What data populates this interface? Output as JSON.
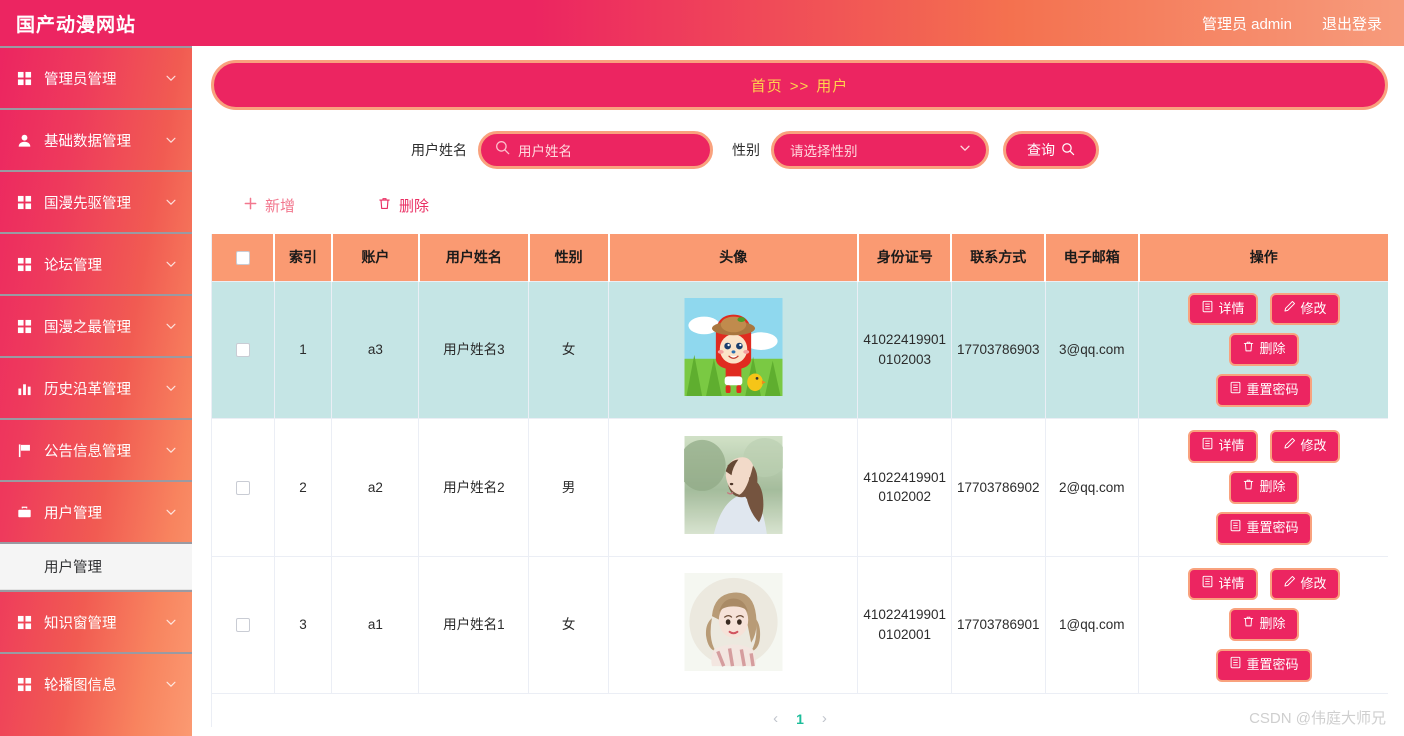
{
  "topbar": {
    "brand": "国产动漫网站",
    "user": "管理员 admin",
    "logout": "退出登录"
  },
  "sidebar": {
    "items": [
      {
        "label": "管理员管理",
        "icon": "grid-icon"
      },
      {
        "label": "基础数据管理",
        "icon": "user-icon"
      },
      {
        "label": "国漫先驱管理",
        "icon": "grid-icon"
      },
      {
        "label": "论坛管理",
        "icon": "grid-icon"
      },
      {
        "label": "国漫之最管理",
        "icon": "grid-icon"
      },
      {
        "label": "历史沿革管理",
        "icon": "bar-chart-icon"
      },
      {
        "label": "公告信息管理",
        "icon": "flag-icon"
      },
      {
        "label": "用户管理",
        "icon": "briefcase-icon",
        "submenu": [
          "用户管理"
        ]
      },
      {
        "label": "知识窗管理",
        "icon": "grid-icon"
      },
      {
        "label": "轮播图信息",
        "icon": "grid-icon"
      }
    ]
  },
  "banner": {
    "home": "首页",
    "separator": ">>",
    "current": "用户"
  },
  "search": {
    "name_label": "用户姓名",
    "name_placeholder": "用户姓名",
    "name_value": "",
    "gender_label": "性别",
    "gender_placeholder": "请选择性别",
    "gender_value": "",
    "query_button": "查询"
  },
  "toolbar": {
    "add_label": "新增",
    "delete_label": "删除"
  },
  "table": {
    "columns": [
      "",
      "索引",
      "账户",
      "用户姓名",
      "性别",
      "头像",
      "身份证号",
      "联系方式",
      "电子邮箱",
      "操作"
    ],
    "rows": [
      {
        "index": "1",
        "account": "a3",
        "name": "用户姓名3",
        "gender": "女",
        "avatar": "cartoon-mascot-avatar",
        "id_number": "410224199010102003",
        "phone": "17703786903",
        "email": "3@qq.com",
        "highlight": true
      },
      {
        "index": "2",
        "account": "a2",
        "name": "用户姓名2",
        "gender": "男",
        "avatar": "photo-girl-profile-avatar",
        "id_number": "410224199010102002",
        "phone": "17703786902",
        "email": "2@qq.com",
        "highlight": false
      },
      {
        "index": "3",
        "account": "a1",
        "name": "用户姓名1",
        "gender": "女",
        "avatar": "illustration-girl-round-avatar",
        "id_number": "410224199010102001",
        "phone": "17703786901",
        "email": "1@qq.com",
        "highlight": false
      }
    ],
    "actions": {
      "detail": "详情",
      "edit": "修改",
      "delete": "删除",
      "reset_password": "重置密码"
    }
  },
  "pagination": {
    "prev": "‹",
    "next": "›",
    "current_page": "1"
  },
  "watermark": "CSDN @伟庭大师兄",
  "colors": {
    "crimson": "#ec2561",
    "orange": "#fa9a72",
    "gold": "#ffd44d",
    "highlight_row": "#c5e5e5",
    "teal": "#1bbd9a"
  }
}
